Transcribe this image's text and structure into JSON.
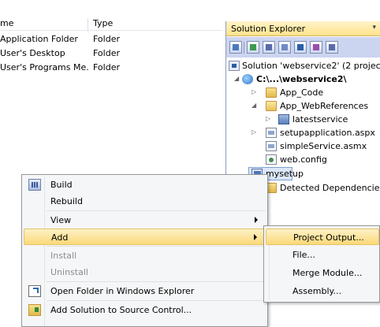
{
  "file_system": {
    "columns": {
      "name": "me",
      "type": "Type"
    },
    "rows": [
      {
        "name": "Application Folder",
        "type": "Folder"
      },
      {
        "name": "User's Desktop",
        "type": "Folder"
      },
      {
        "name": "User's Programs Me...",
        "type": "Folder"
      }
    ]
  },
  "solution_explorer": {
    "title": "Solution Explorer",
    "pin_glyph": "▾",
    "tree": [
      {
        "label": "Solution 'webservice2' (2 project",
        "icon": "solution-icon"
      },
      {
        "label": "C:\\...\\webservice2\\",
        "icon": "website-icon",
        "bold": true
      },
      {
        "label": "App_Code",
        "icon": "folder-icon"
      },
      {
        "label": "App_WebReferences",
        "icon": "folder-open-icon"
      },
      {
        "label": "latestservice",
        "icon": "web-reference-icon"
      },
      {
        "label": "setupapplication.aspx",
        "icon": "aspx-page-icon"
      },
      {
        "label": "simpleService.asmx",
        "icon": "asmx-service-icon"
      },
      {
        "label": "web.config",
        "icon": "config-icon"
      },
      {
        "label": "mysetup",
        "icon": "setup-project-icon"
      },
      {
        "label": "Detected Dependencies",
        "icon": "folder-icon"
      }
    ]
  },
  "context_menu": {
    "items": [
      {
        "label": "Build",
        "icon": "build-icon"
      },
      {
        "label": "Rebuild"
      },
      {
        "label": "View",
        "submenu": true
      },
      {
        "label": "Add",
        "submenu": true,
        "highlighted": true
      },
      {
        "label": "Install",
        "disabled": true
      },
      {
        "label": "Uninstall",
        "disabled": true
      },
      {
        "label": "Open Folder in Windows Explorer",
        "icon": "open-folder-icon"
      },
      {
        "label": "Add Solution to Source Control...",
        "icon": "source-control-icon"
      }
    ]
  },
  "add_submenu": {
    "items": [
      {
        "label": "Project Output...",
        "highlighted": true
      },
      {
        "label": "File..."
      },
      {
        "label": "Merge Module..."
      },
      {
        "label": "Assembly..."
      }
    ]
  }
}
